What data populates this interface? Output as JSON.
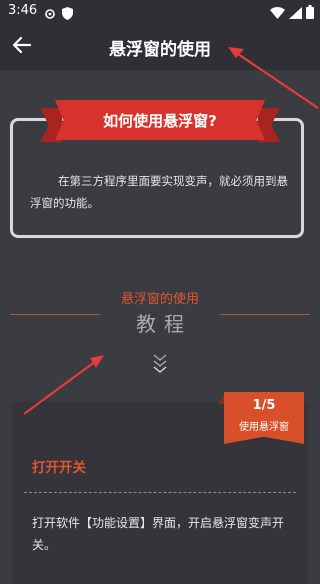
{
  "status_bar": {
    "time": "3:46",
    "icons": [
      "settings-icon",
      "shield-icon",
      "wifi-icon",
      "signal-icon",
      "battery-icon"
    ]
  },
  "app_bar": {
    "back_icon": "back-arrow-icon",
    "title": "悬浮窗的使用"
  },
  "faq": {
    "banner_title": "如何使用悬浮窗?",
    "body": "在第三方程序里面要实现变声，就必须用到悬浮窗的功能。"
  },
  "tutorial": {
    "subtitle": "悬浮窗的使用",
    "title": "教程",
    "chevron_icon": "double-chevron-down-icon"
  },
  "step": {
    "count": "1/5",
    "tag_label": "使用悬浮窗",
    "title": "打开开关",
    "body": "打开软件【功能设置】界面，开启悬浮窗变声开关。"
  },
  "colors": {
    "background": "#3b3b42",
    "bar": "#2f2f35",
    "accent_red": "#d7322c",
    "accent_orange": "#e2562b"
  }
}
